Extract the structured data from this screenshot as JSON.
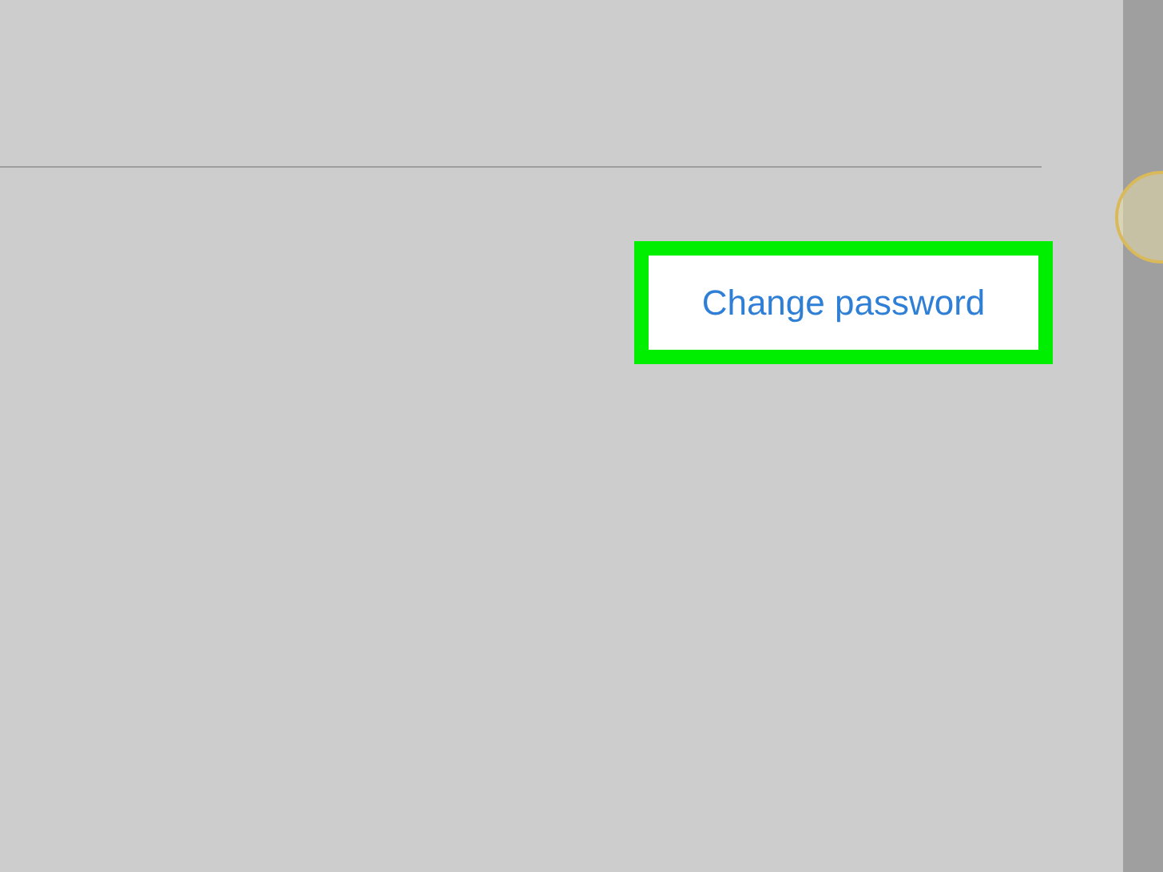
{
  "button": {
    "label": "Change password",
    "highlighted": true
  }
}
